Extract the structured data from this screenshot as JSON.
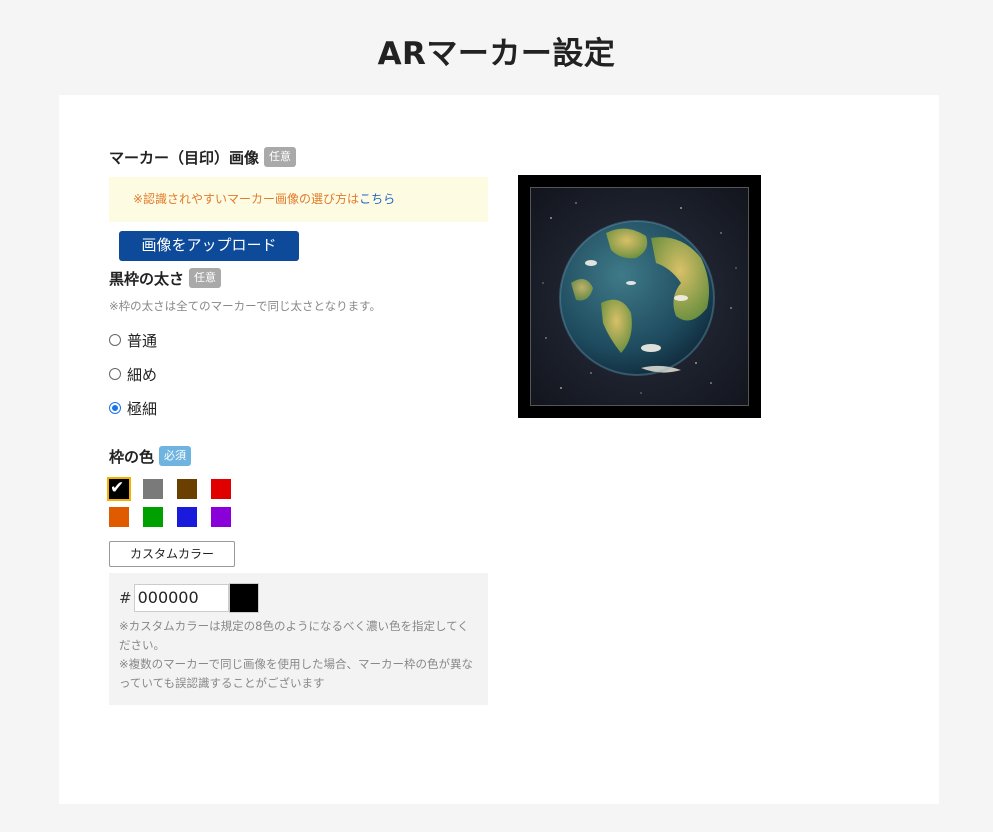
{
  "page": {
    "title": "ARマーカー設定"
  },
  "marker_image": {
    "label": "マーカー（目印）画像",
    "badge": "任意",
    "hint_prefix": "※認識されやすいマーカー画像の選び方は",
    "hint_link": "こちら",
    "upload_label": "画像をアップロード"
  },
  "frame_thickness": {
    "label": "黒枠の太さ",
    "badge": "任意",
    "note": "※枠の太さは全てのマーカーで同じ太さとなります。",
    "options": [
      {
        "label": "普通",
        "checked": false
      },
      {
        "label": "細め",
        "checked": false
      },
      {
        "label": "極細",
        "checked": true
      }
    ]
  },
  "frame_color": {
    "label": "枠の色",
    "badge": "必須",
    "swatches": [
      "#000000",
      "#7a7a7a",
      "#6b3f00",
      "#e00000",
      "#e05a00",
      "#00a000",
      "#1a1adc",
      "#8a00d8"
    ],
    "selected_index": 0,
    "custom_button_label": "カスタムカラー",
    "hash_symbol": "#",
    "hex_value": "000000",
    "preview_color": "#000000",
    "note_line1": "※カスタムカラーは規定の8色のようになるべく濃い色を指定してください。",
    "note_line2": "※複数のマーカーで同じ画像を使用した場合、マーカー枠の色が異なっていても誤認識することがございます"
  },
  "preview": {
    "image_icon": "earth-globe-icon"
  }
}
